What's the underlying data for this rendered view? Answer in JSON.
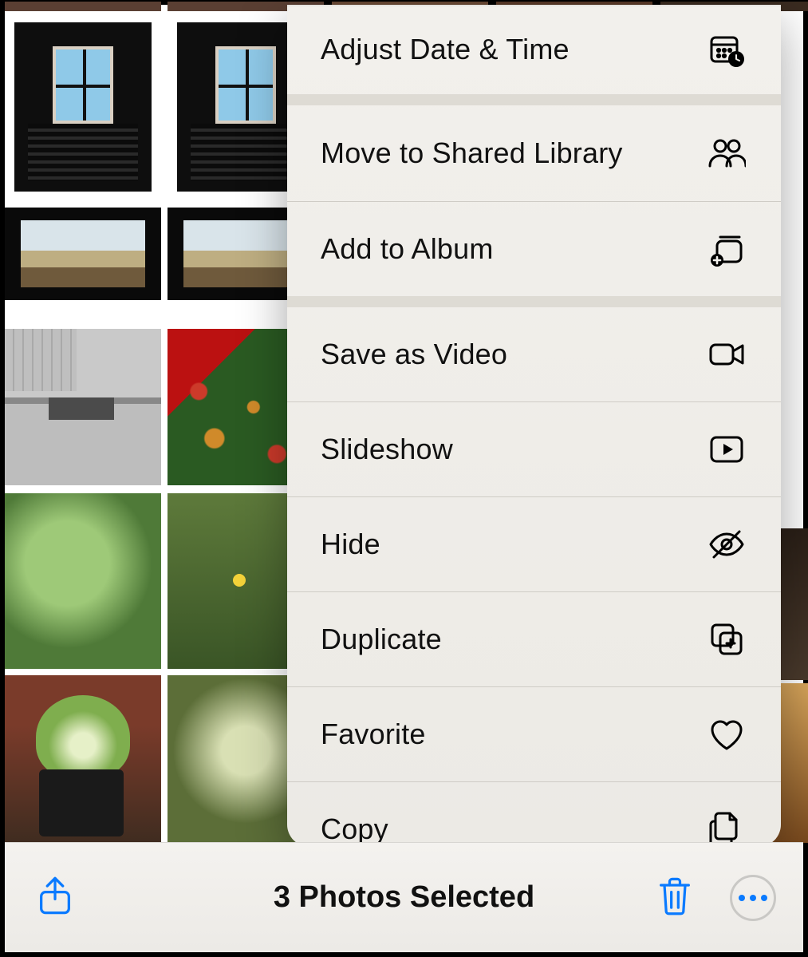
{
  "toolbar": {
    "selected_label": "3 Photos Selected"
  },
  "menu": {
    "items": [
      {
        "label": "Adjust Date & Time",
        "icon": "calendar-clock-icon"
      },
      {
        "label": "Move to Shared Library",
        "icon": "people-icon"
      },
      {
        "label": "Add to Album",
        "icon": "add-to-album-icon"
      },
      {
        "label": "Save as Video",
        "icon": "video-icon"
      },
      {
        "label": "Slideshow",
        "icon": "play-rect-icon"
      },
      {
        "label": "Hide",
        "icon": "eye-slash-icon"
      },
      {
        "label": "Duplicate",
        "icon": "duplicate-plus-icon"
      },
      {
        "label": "Favorite",
        "icon": "heart-icon"
      },
      {
        "label": "Copy",
        "icon": "documents-icon"
      }
    ]
  }
}
